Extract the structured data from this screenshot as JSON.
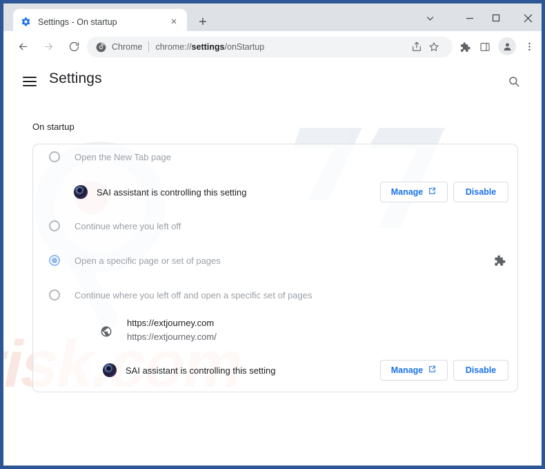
{
  "window": {
    "frame_color": "#2c5694",
    "caption": {
      "chevron": "chevron-down",
      "minimize": "minimize",
      "maximize": "maximize",
      "close": "close"
    }
  },
  "tabstrip": {
    "tab": {
      "title": "Settings - On startup",
      "favicon": "settings-gear-icon",
      "close_label": "×"
    },
    "new_tab_label": "+"
  },
  "toolbar": {
    "back": "back-arrow-icon",
    "forward": "forward-arrow-icon",
    "reload": "reload-icon",
    "omnibox": {
      "scheme_label": "Chrome",
      "url_prefix": "chrome://",
      "url_bold": "settings",
      "url_suffix": "/onStartup",
      "full_url": "chrome://settings/onStartup"
    },
    "share": "share-icon",
    "bookmark": "star-icon",
    "extensions": "puzzle-piece-icon",
    "side_panel": "side-panel-icon",
    "profile": "avatar-icon",
    "menu": "three-dot-menu-icon"
  },
  "settings": {
    "title": "Settings",
    "hamburger": "hamburger-menu-icon",
    "search": "search-icon",
    "section_title": "On startup",
    "accent_color": "#1a73e8",
    "radio_checked_color": "#90b9ee",
    "options": [
      {
        "label": "Open the New Tab page",
        "checked": false
      },
      {
        "label": "Continue where you left off",
        "checked": false
      },
      {
        "label": "Open a specific page or set of pages",
        "checked": true
      },
      {
        "label": "Continue where you left off and open a specific set of pages",
        "checked": false
      }
    ],
    "controlled_notices": [
      {
        "icon": "sai-assistant-icon",
        "text": "SAI assistant is controlling this setting",
        "manage_label": "Manage",
        "manage_icon": "external-link-icon",
        "disable_label": "Disable"
      },
      {
        "icon": "sai-assistant-icon",
        "text": "SAI assistant is controlling this setting",
        "manage_label": "Manage",
        "manage_icon": "external-link-icon",
        "disable_label": "Disable"
      }
    ],
    "startup_page": {
      "icon": "globe-icon",
      "primary": "https://extjourney.com",
      "secondary": "https://extjourney.com/"
    },
    "extension_badge": "puzzle-piece-icon"
  },
  "watermark": {
    "text": "risk.com",
    "logo": "pc",
    "color": "#f5e5e0"
  }
}
